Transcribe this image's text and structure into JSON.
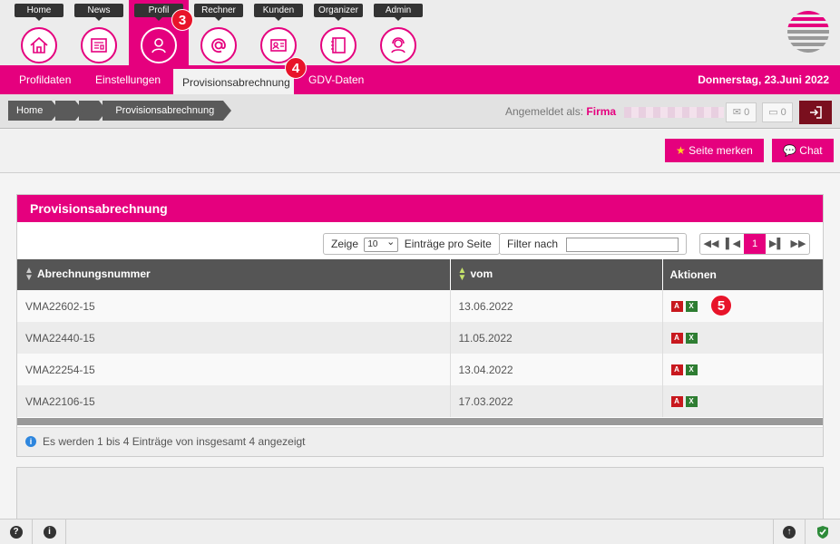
{
  "topnav": {
    "items": [
      {
        "label": "Home",
        "icon": "house-icon"
      },
      {
        "label": "News",
        "icon": "newspaper-icon"
      },
      {
        "label": "Profil",
        "icon": "person-icon"
      },
      {
        "label": "Rechner",
        "icon": "at-icon"
      },
      {
        "label": "Kunden",
        "icon": "contact-card-icon"
      },
      {
        "label": "Organizer",
        "icon": "notebook-icon"
      },
      {
        "label": "Admin",
        "icon": "headset-user-icon"
      }
    ],
    "active": "Profil"
  },
  "annotations": {
    "three": "3",
    "four": "4",
    "five": "5"
  },
  "subnav": {
    "tabs": [
      "Profildaten",
      "Einstellungen",
      "Provisionsabrechnung",
      "GDV-Daten"
    ],
    "active": "Provisionsabrechnung",
    "date": "Donnerstag, 23.Juni 2022"
  },
  "breadcrumb": {
    "home": "Home",
    "current": "Provisionsabrechnung"
  },
  "session": {
    "logged_in_label": "Angemeldet als:",
    "company": "Firma",
    "messages_count": "0",
    "chat_count": "0"
  },
  "actions": {
    "bookmark": "Seite merken",
    "chat": "Chat"
  },
  "panel": {
    "title": "Provisionsabrechnung",
    "show_prefix": "Zeige",
    "page_size": "10",
    "show_suffix": "Einträge pro Seite",
    "filter_label": "Filter nach",
    "current_page": "1",
    "columns": [
      "Abrechnungsnummer",
      "vom",
      "Aktionen"
    ],
    "rows": [
      {
        "number": "VMA22602-15",
        "date": "13.06.2022"
      },
      {
        "number": "VMA22440-15",
        "date": "11.05.2022"
      },
      {
        "number": "VMA22254-15",
        "date": "13.04.2022"
      },
      {
        "number": "VMA22106-15",
        "date": "17.03.2022"
      }
    ],
    "info": "Es werden 1 bis 4 Einträge von insgesamt 4 angezeigt"
  },
  "colors": {
    "brand": "#e5007e",
    "logout": "#7a0f1e"
  }
}
